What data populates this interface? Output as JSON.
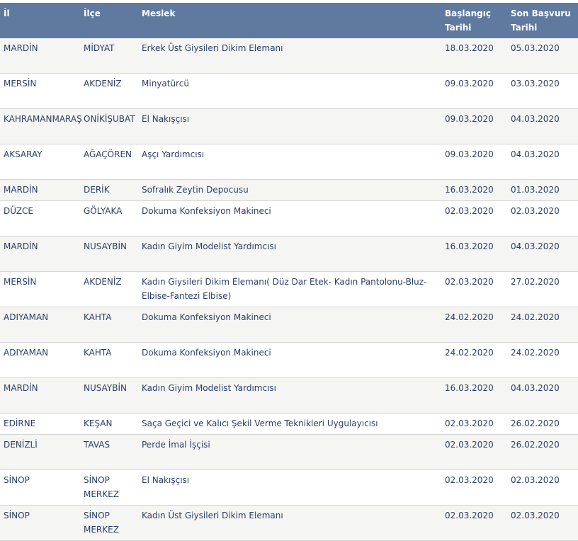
{
  "headers": [
    "İl",
    "İlçe",
    "Meslek",
    "Başlangıç Tarihi",
    "Son Başvuru Tarihi"
  ],
  "rows": [
    {
      "il": "MARDİN",
      "ilce": "MİDYAT",
      "meslek": "Erkek Üst Giysileri Dikim Elemanı",
      "baslangic": "18.03.2020",
      "son": "05.03.2020"
    },
    {
      "il": "MERSİN",
      "ilce": "AKDENİZ",
      "meslek": "Minyatürcü",
      "baslangic": "09.03.2020",
      "son": "03.03.2020"
    },
    {
      "il": "KAHRAMANMARAŞ",
      "ilce": "ONİKİŞUBAT",
      "meslek": "El Nakışçısı",
      "baslangic": "09.03.2020",
      "son": "04.03.2020"
    },
    {
      "il": "AKSARAY",
      "ilce": "AĞAÇÖREN",
      "meslek": "Aşçı Yardımcısı",
      "baslangic": "09.03.2020",
      "son": "04.03.2020"
    },
    {
      "il": "MARDİN",
      "ilce": "DERİK",
      "meslek": "Sofralık Zeytin Depocusu",
      "baslangic": "16.03.2020",
      "son": "01.03.2020"
    },
    {
      "il": "DÜZCE",
      "ilce": "GÖLYAKA",
      "meslek": "Dokuma Konfeksiyon Makineci",
      "baslangic": "02.03.2020",
      "son": "02.03.2020"
    },
    {
      "il": "MARDİN",
      "ilce": "NUSAYBİN",
      "meslek": "Kadın Giyim Modelist Yardımcısı",
      "baslangic": "16.03.2020",
      "son": "04.03.2020"
    },
    {
      "il": "MERSİN",
      "ilce": "AKDENİZ",
      "meslek": "Kadın Giysileri Dikim Elemanı( Düz Dar Etek- Kadın Pantolonu-Bluz- Elbise-Fantezi Elbise)",
      "baslangic": "02.03.2020",
      "son": "27.02.2020"
    },
    {
      "il": "ADIYAMAN",
      "ilce": "KAHTA",
      "meslek": "Dokuma Konfeksiyon Makineci",
      "baslangic": "24.02.2020",
      "son": "24.02.2020"
    },
    {
      "il": "ADIYAMAN",
      "ilce": "KAHTA",
      "meslek": "Dokuma Konfeksiyon Makineci",
      "baslangic": "24.02.2020",
      "son": "24.02.2020"
    },
    {
      "il": "MARDİN",
      "ilce": "NUSAYBİN",
      "meslek": "Kadın Giyim Modelist Yardımcısı",
      "baslangic": "16.03.2020",
      "son": "04.03.2020"
    },
    {
      "il": "EDİRNE",
      "ilce": "KEŞAN",
      "meslek": "Saça Geçici ve Kalıcı Şekil Verme Teknikleri Uygulayıcısı",
      "baslangic": "02.03.2020",
      "son": "26.02.2020"
    },
    {
      "il": "DENİZLİ",
      "ilce": "TAVAS",
      "meslek": "Perde İmal İşçisi",
      "baslangic": "02.03.2020",
      "son": "26.02.2020"
    },
    {
      "il": "SİNOP",
      "ilce": "SİNOP MERKEZ",
      "meslek": "El Nakışçısı",
      "baslangic": "02.03.2020",
      "son": "02.03.2020"
    },
    {
      "il": "SİNOP",
      "ilce": "SİNOP MERKEZ",
      "meslek": "Kadın Üst Giysileri Dikim Elemanı",
      "baslangic": "02.03.2020",
      "son": "02.03.2020"
    }
  ]
}
